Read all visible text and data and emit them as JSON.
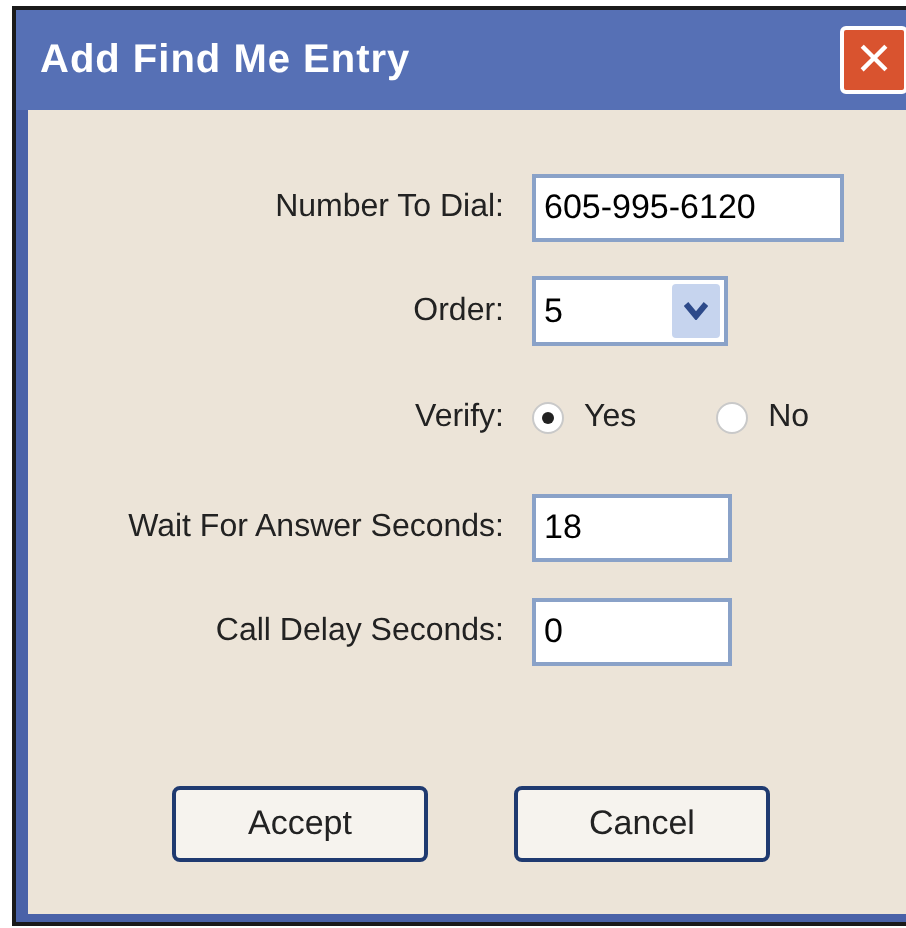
{
  "window": {
    "title": "Add Find Me Entry",
    "close": "×"
  },
  "fields": [
    {
      "kind": "text",
      "label": "Number To Dial:",
      "value": "605-995-6120"
    },
    {
      "kind": "select",
      "label": "Order:",
      "value": "5"
    },
    {
      "kind": "radio",
      "label": "Verify:",
      "options": [
        {
          "label": "Yes",
          "selected": true
        },
        {
          "label": "No",
          "selected": false
        }
      ]
    },
    {
      "kind": "text",
      "label": "Wait For Answer Seconds:",
      "value": "18"
    },
    {
      "kind": "text",
      "label": "Call Delay Seconds:",
      "value": "0"
    }
  ],
  "buttons": [
    "Accept",
    "Cancel"
  ]
}
